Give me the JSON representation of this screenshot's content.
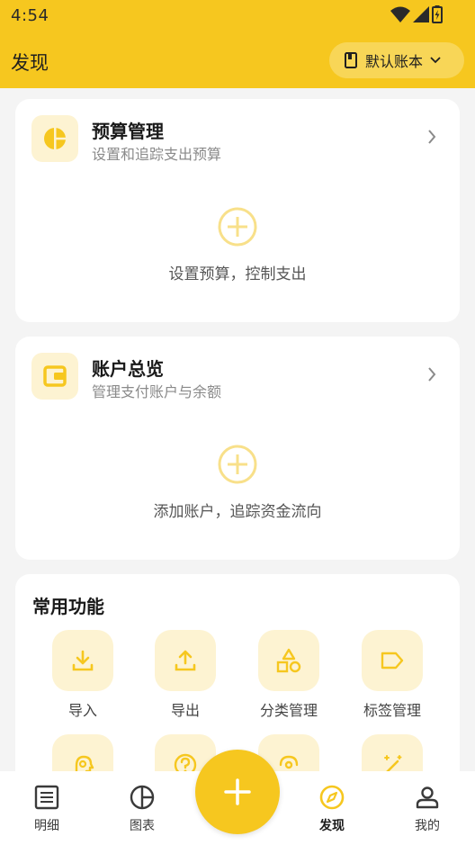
{
  "status": {
    "time": "4:54"
  },
  "header": {
    "title": "发现",
    "ledger_label": "默认账本"
  },
  "budget": {
    "title": "预算管理",
    "subtitle": "设置和追踪支出预算",
    "empty_text": "设置预算，控制支出"
  },
  "accounts": {
    "title": "账户总览",
    "subtitle": "管理支付账户与余额",
    "empty_text": "添加账户，追踪资金流向"
  },
  "functions": {
    "title": "常用功能",
    "items": [
      {
        "label": "导入",
        "icon": "import-icon"
      },
      {
        "label": "导出",
        "icon": "export-icon"
      },
      {
        "label": "分类管理",
        "icon": "category-icon"
      },
      {
        "label": "标签管理",
        "icon": "tag-icon"
      }
    ]
  },
  "nav": {
    "items": [
      {
        "label": "明细",
        "icon": "list-icon"
      },
      {
        "label": "图表",
        "icon": "pie-icon"
      },
      {
        "label": "发现",
        "icon": "compass-icon",
        "active": true
      },
      {
        "label": "我的",
        "icon": "user-icon"
      }
    ]
  },
  "colors": {
    "accent": "#f6c71f",
    "icon_bg": "#fdf3d2",
    "background": "#f4f4f4"
  }
}
